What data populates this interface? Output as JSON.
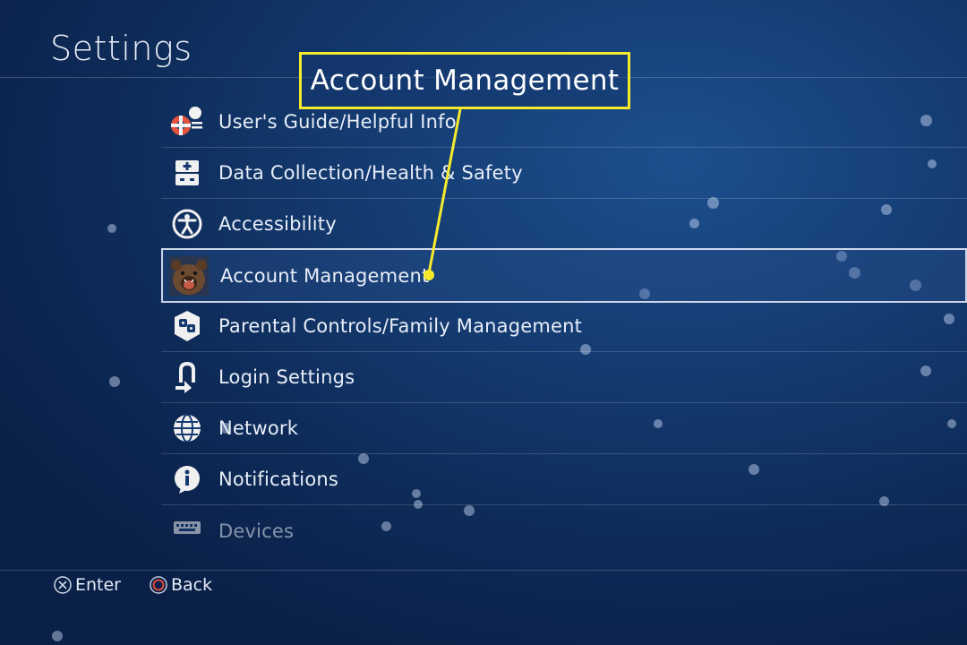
{
  "screen": {
    "title": "Settings"
  },
  "callout": {
    "label": "Account Management",
    "color": "#f5ea2c"
  },
  "menu": {
    "items": [
      {
        "label": "User's Guide/Helpful Info",
        "icon": "lifebuoy-icon"
      },
      {
        "label": "Data Collection/Health & Safety",
        "icon": "health-safety-icon"
      },
      {
        "label": "Accessibility",
        "icon": "accessibility-icon"
      },
      {
        "label": "Account Management",
        "icon": "user-avatar-bear",
        "selected": true
      },
      {
        "label": "Parental Controls/Family Management",
        "icon": "parental-controls-icon"
      },
      {
        "label": "Login Settings",
        "icon": "login-icon"
      },
      {
        "label": "Network",
        "icon": "globe-icon"
      },
      {
        "label": "Notifications",
        "icon": "info-icon"
      },
      {
        "label": "Devices",
        "icon": "keyboard-icon"
      }
    ]
  },
  "footer": {
    "enter": {
      "label": "Enter",
      "glyph": "cross-button-icon"
    },
    "back": {
      "label": "Back",
      "glyph": "circle-button-icon",
      "color": "#e04a3a"
    }
  }
}
